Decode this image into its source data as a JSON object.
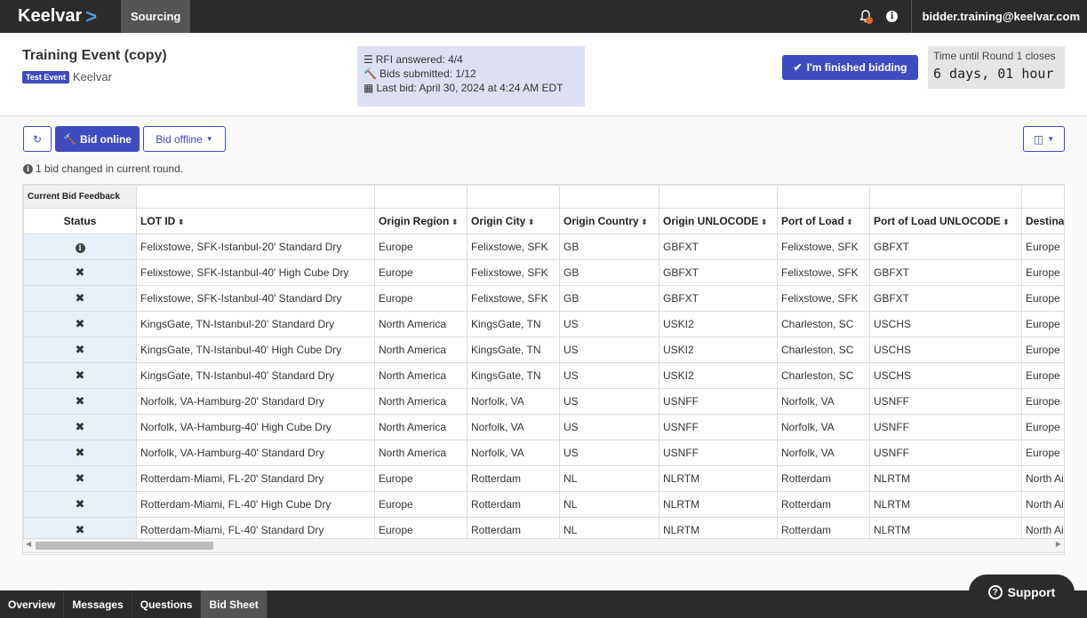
{
  "nav": {
    "brand": "Keelvar",
    "brand_chevron": ">",
    "tab": "Sourcing",
    "user": "bidder.training@keelvar.com"
  },
  "event": {
    "title": "Training Event (copy)",
    "badge": "Test Event",
    "org": "Keelvar",
    "rfi": "RFI answered: 4/4",
    "bids": "Bids submitted: 1/12",
    "last_bid": "Last bid: April 30, 2024 at 4:24 AM EDT",
    "finish_label": "I'm finished bidding",
    "timer_label": "Time until Round 1 closes",
    "timer_value": "6 days, 01 hour"
  },
  "toolbar": {
    "bid_online": "Bid online",
    "bid_offline": "Bid offline",
    "notice": "1 bid changed in current round."
  },
  "table": {
    "group_header": "Current Bid Feedback",
    "columns": [
      "Status",
      "LOT ID",
      "Origin Region",
      "Origin City",
      "Origin Country",
      "Origin UNLOCODE",
      "Port of Load",
      "Port of Load UNLOCODE",
      "Destina"
    ],
    "rows": [
      {
        "status": "info",
        "lot": "Felixstowe, SFK-Istanbul-20' Standard Dry",
        "region": "Europe",
        "city": "Felixstowe, SFK",
        "country": "GB",
        "unlocode": "GBFXT",
        "pol": "Felixstowe, SFK",
        "pol_code": "GBFXT",
        "dest": "Europe"
      },
      {
        "status": "x",
        "lot": "Felixstowe, SFK-Istanbul-40' High Cube Dry",
        "region": "Europe",
        "city": "Felixstowe, SFK",
        "country": "GB",
        "unlocode": "GBFXT",
        "pol": "Felixstowe, SFK",
        "pol_code": "GBFXT",
        "dest": "Europe"
      },
      {
        "status": "x",
        "lot": "Felixstowe, SFK-Istanbul-40' Standard Dry",
        "region": "Europe",
        "city": "Felixstowe, SFK",
        "country": "GB",
        "unlocode": "GBFXT",
        "pol": "Felixstowe, SFK",
        "pol_code": "GBFXT",
        "dest": "Europe"
      },
      {
        "status": "x",
        "lot": "KingsGate, TN-Istanbul-20' Standard Dry",
        "region": "North America",
        "city": "KingsGate, TN",
        "country": "US",
        "unlocode": "USKI2",
        "pol": "Charleston, SC",
        "pol_code": "USCHS",
        "dest": "Europe"
      },
      {
        "status": "x",
        "lot": "KingsGate, TN-Istanbul-40' High Cube Dry",
        "region": "North America",
        "city": "KingsGate, TN",
        "country": "US",
        "unlocode": "USKI2",
        "pol": "Charleston, SC",
        "pol_code": "USCHS",
        "dest": "Europe"
      },
      {
        "status": "x",
        "lot": "KingsGate, TN-Istanbul-40' Standard Dry",
        "region": "North America",
        "city": "KingsGate, TN",
        "country": "US",
        "unlocode": "USKI2",
        "pol": "Charleston, SC",
        "pol_code": "USCHS",
        "dest": "Europe"
      },
      {
        "status": "x",
        "lot": "Norfolk, VA-Hamburg-20' Standard Dry",
        "region": "North America",
        "city": "Norfolk, VA",
        "country": "US",
        "unlocode": "USNFF",
        "pol": "Norfolk, VA",
        "pol_code": "USNFF",
        "dest": "Europe"
      },
      {
        "status": "x",
        "lot": "Norfolk, VA-Hamburg-40' High Cube Dry",
        "region": "North America",
        "city": "Norfolk, VA",
        "country": "US",
        "unlocode": "USNFF",
        "pol": "Norfolk, VA",
        "pol_code": "USNFF",
        "dest": "Europe"
      },
      {
        "status": "x",
        "lot": "Norfolk, VA-Hamburg-40' Standard Dry",
        "region": "North America",
        "city": "Norfolk, VA",
        "country": "US",
        "unlocode": "USNFF",
        "pol": "Norfolk, VA",
        "pol_code": "USNFF",
        "dest": "Europe"
      },
      {
        "status": "x",
        "lot": "Rotterdam-Miami, FL-20' Standard Dry",
        "region": "Europe",
        "city": "Rotterdam",
        "country": "NL",
        "unlocode": "NLRTM",
        "pol": "Rotterdam",
        "pol_code": "NLRTM",
        "dest": "North Ai"
      },
      {
        "status": "x",
        "lot": "Rotterdam-Miami, FL-40' High Cube Dry",
        "region": "Europe",
        "city": "Rotterdam",
        "country": "NL",
        "unlocode": "NLRTM",
        "pol": "Rotterdam",
        "pol_code": "NLRTM",
        "dest": "North Ai"
      },
      {
        "status": "x",
        "lot": "Rotterdam-Miami, FL-40' Standard Dry",
        "region": "Europe",
        "city": "Rotterdam",
        "country": "NL",
        "unlocode": "NLRTM",
        "pol": "Rotterdam",
        "pol_code": "NLRTM",
        "dest": "North Ai"
      }
    ]
  },
  "bottom_tabs": [
    "Overview",
    "Messages",
    "Questions",
    "Bid Sheet"
  ],
  "active_tab": "Bid Sheet",
  "support_label": "Support",
  "colors": {
    "primary": "#3f4bc0",
    "nav": "#2b2b2b",
    "status_bg": "#e8f1fa"
  }
}
